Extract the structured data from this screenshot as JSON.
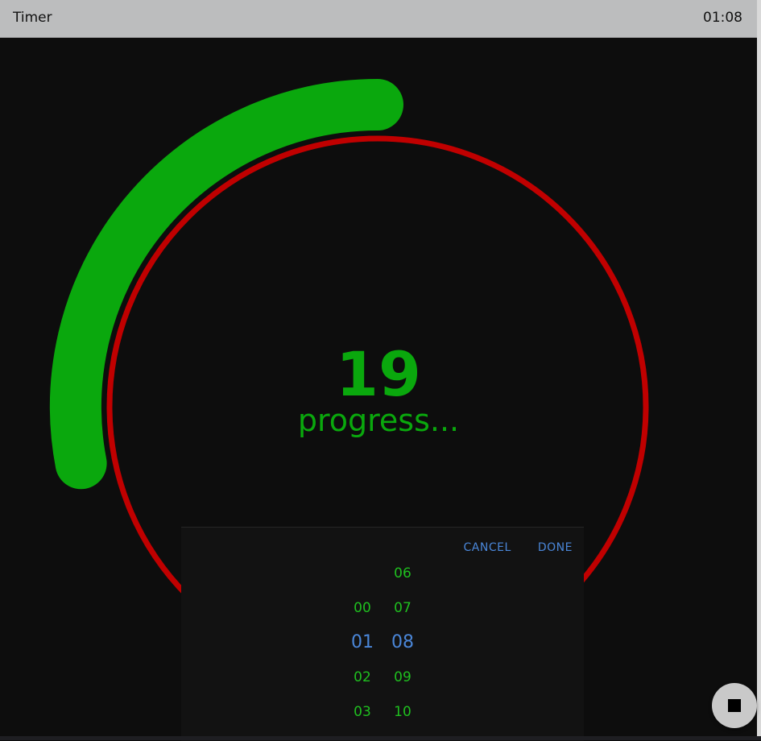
{
  "window": {
    "title": "Timer",
    "clock": "01:08"
  },
  "timer": {
    "value": "19",
    "status": "progress...",
    "progress_fraction": 0.28
  },
  "picker": {
    "cancel_label": "CANCEL",
    "done_label": "DONE",
    "hours": [
      "",
      "00",
      "01",
      "02",
      "03"
    ],
    "minutes": [
      "06",
      "07",
      "08",
      "09",
      "10"
    ],
    "selected_index": 2
  },
  "colors": {
    "background": "#0d0d0d",
    "progress_arc": "#0aa80d",
    "ring": "#c00000",
    "accent": "#4a86d8",
    "picker_digits": "#1fbf1f"
  },
  "fab": {
    "icon": "stop-icon"
  }
}
